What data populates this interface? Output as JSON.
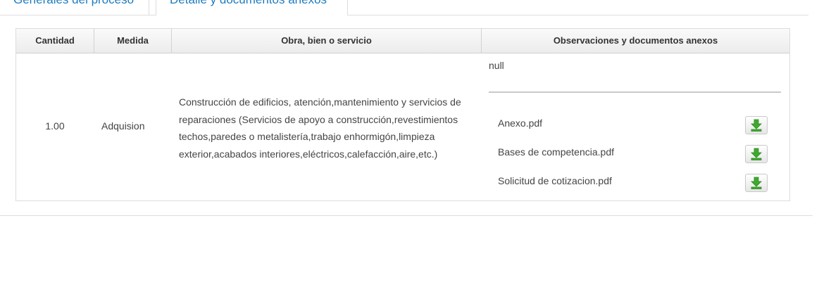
{
  "tabs": [
    {
      "label": "Generales del proceso",
      "active": false
    },
    {
      "label": "Detalle y documentos anexos",
      "active": true
    }
  ],
  "table": {
    "columns": [
      "Cantidad",
      "Medida",
      "Obra, bien o servicio",
      "Observaciones y documentos anexos"
    ],
    "row": {
      "cantidad": "1.00",
      "medida": "Adquision",
      "obra_lines": [
        "Construcción de edificios, atención,mantenimiento y servicios de",
        "reparaciones (Servicios de apoyo a construcción,revestimientos",
        "techos,paredes o metalistería,trabajo enhormigón,limpieza",
        "exterior,acabados interiores,eléctricos,calefacción,aire,etc.)"
      ],
      "observaciones": "null",
      "files": [
        {
          "name": "Anexo.pdf",
          "icon": "download-icon"
        },
        {
          "name": "Bases de competencia.pdf",
          "icon": "download-icon"
        },
        {
          "name": "Solicitud de cotizacion.pdf",
          "icon": "download-icon"
        }
      ]
    }
  },
  "colors": {
    "tab_text": "#1f7bbf",
    "download_arrow": "#3cab2d"
  }
}
